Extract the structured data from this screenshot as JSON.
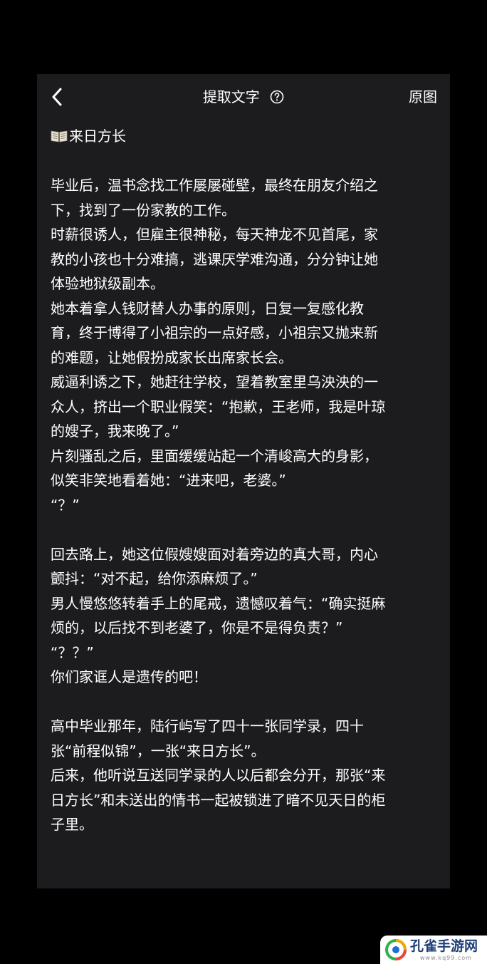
{
  "header": {
    "title": "提取文字",
    "original_label": "原图"
  },
  "icons": {
    "back": "chevron-left-icon",
    "help": "question-circle-icon",
    "book": "open-book-icon"
  },
  "content": {
    "book_title": "来日方长",
    "lines": [
      "",
      "毕业后，温书念找工作屡屡碰壁，最终在朋友介绍之",
      "下，找到了一份家教的工作。",
      "时薪很诱人，但雇主很神秘，每天神龙不见首尾，家",
      "教的小孩也十分难搞，逃课厌学难沟通，分分钟让她",
      "体验地狱级副本。",
      "她本着拿人钱财替人办事的原则，日复一复感化教",
      "育，终于博得了小祖宗的一点好感，小祖宗又抛来新",
      "的难题，让她假扮成家长出席家长会。",
      "威逼利诱之下，她赶往学校，望着教室里乌泱泱的一",
      "众人，挤出一个职业假笑：“抱歉，王老师，我是叶琼",
      "的嫂子，我来晚了。”",
      "片刻骚乱之后，里面缓缓站起一个清峻高大的身影，",
      "似笑非笑地看着她：“进来吧，老婆。”",
      "“？”",
      "",
      "回去路上，她这位假嫂嫂面对着旁边的真大哥，内心",
      "颤抖：“对不起，给你添麻烦了。”",
      "男人慢悠悠转着手上的尾戒，遗憾叹着气：“确实挺麻",
      "烦的，以后找不到老婆了，你是不是得负责？”",
      "“？？”",
      "你们家诓人是遗传的吧！",
      "",
      "高中毕业那年，陆行屿写了四十一张同学录，四十",
      "张“前程似锦”，一张“来日方长”。",
      "后来，他听说互送同学录的人以后都会分开，那张“来",
      "日方长”和未送出的情书一起被锁进了暗不见天日的柜",
      "子里。"
    ]
  },
  "watermark": {
    "name": "孔雀手游网",
    "url": "www.kq99.com"
  },
  "colors": {
    "page_bg": "#000000",
    "panel_bg": "#1c1c1e",
    "text": "#ffffff",
    "watermark_text": "#1f3f7a"
  }
}
